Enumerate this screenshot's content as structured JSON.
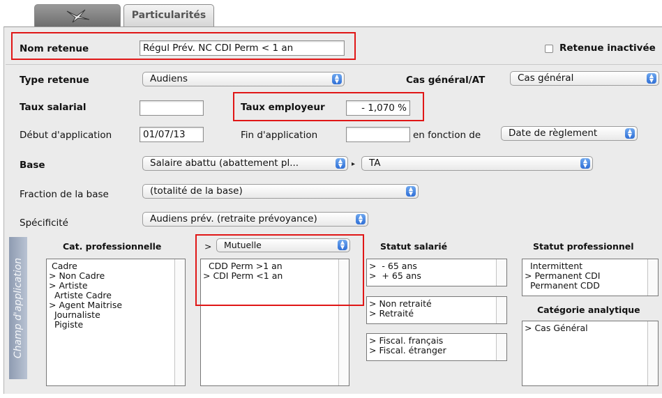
{
  "tabs": {
    "icon_tab": "flying-bird-icon",
    "particularites": "Particularités"
  },
  "row_nom": {
    "label": "Nom retenue",
    "value": "Régul Prév. NC CDI Perm < 1 an",
    "inactive_label": "Retenue inactivée"
  },
  "row_type": {
    "label": "Type retenue",
    "value": "Audiens",
    "cas_label": "Cas général/AT",
    "cas_value": "Cas général"
  },
  "row_taux": {
    "salarial_label": "Taux salarial",
    "salarial_value": "",
    "employeur_label": "Taux employeur",
    "employeur_value": "- 1,070 %"
  },
  "row_dates": {
    "debut_label": "Début d'application",
    "debut_value": "01/07/13",
    "fin_label": "Fin d'application",
    "fin_value": "",
    "fonction_label": "en fonction de",
    "fonction_value": "Date de règlement"
  },
  "row_base": {
    "label": "Base",
    "value": "Salaire abattu (abattement pl...",
    "value2": "TA"
  },
  "row_fraction": {
    "label": "Fraction de la base",
    "value": "(totalité de la base)"
  },
  "row_specificite": {
    "label": "Spécificité",
    "value": "Audiens prév. (retraite prévoyance)"
  },
  "champ": {
    "sidebar_label": "Champ d'application",
    "cat_header": "Cat. professionnelle",
    "cat_items": [
      " Cadre",
      "> Non Cadre",
      "> Artiste",
      "  Artiste Cadre",
      "> Agent Maitrise",
      "  Journaliste",
      "  Pigiste"
    ],
    "mutuelle_prefix": ">",
    "mutuelle_value": "Mutuelle",
    "mutuelle_items": [
      "  CDD Perm >1 an",
      "> CDI Perm <1 an"
    ],
    "statut_salarie_header": "Statut salarié",
    "age_items": [
      ">  - 65 ans",
      ">  + 65 ans"
    ],
    "retraite_items": [
      "> Non retraité",
      "> Retraité"
    ],
    "fiscal_items": [
      "> Fiscal. français",
      "> Fiscal. étranger"
    ],
    "statut_pro_header": "Statut professionnel",
    "statut_pro_items": [
      "  Intermittent",
      "> Permanent CDI",
      "  Permanent CDD"
    ],
    "cat_analytique_header": "Catégorie analytique",
    "cat_analytique_items": [
      "> Cas Général"
    ]
  },
  "colors": {
    "highlight": "#e01616",
    "stepper": "#2f6fd6"
  }
}
